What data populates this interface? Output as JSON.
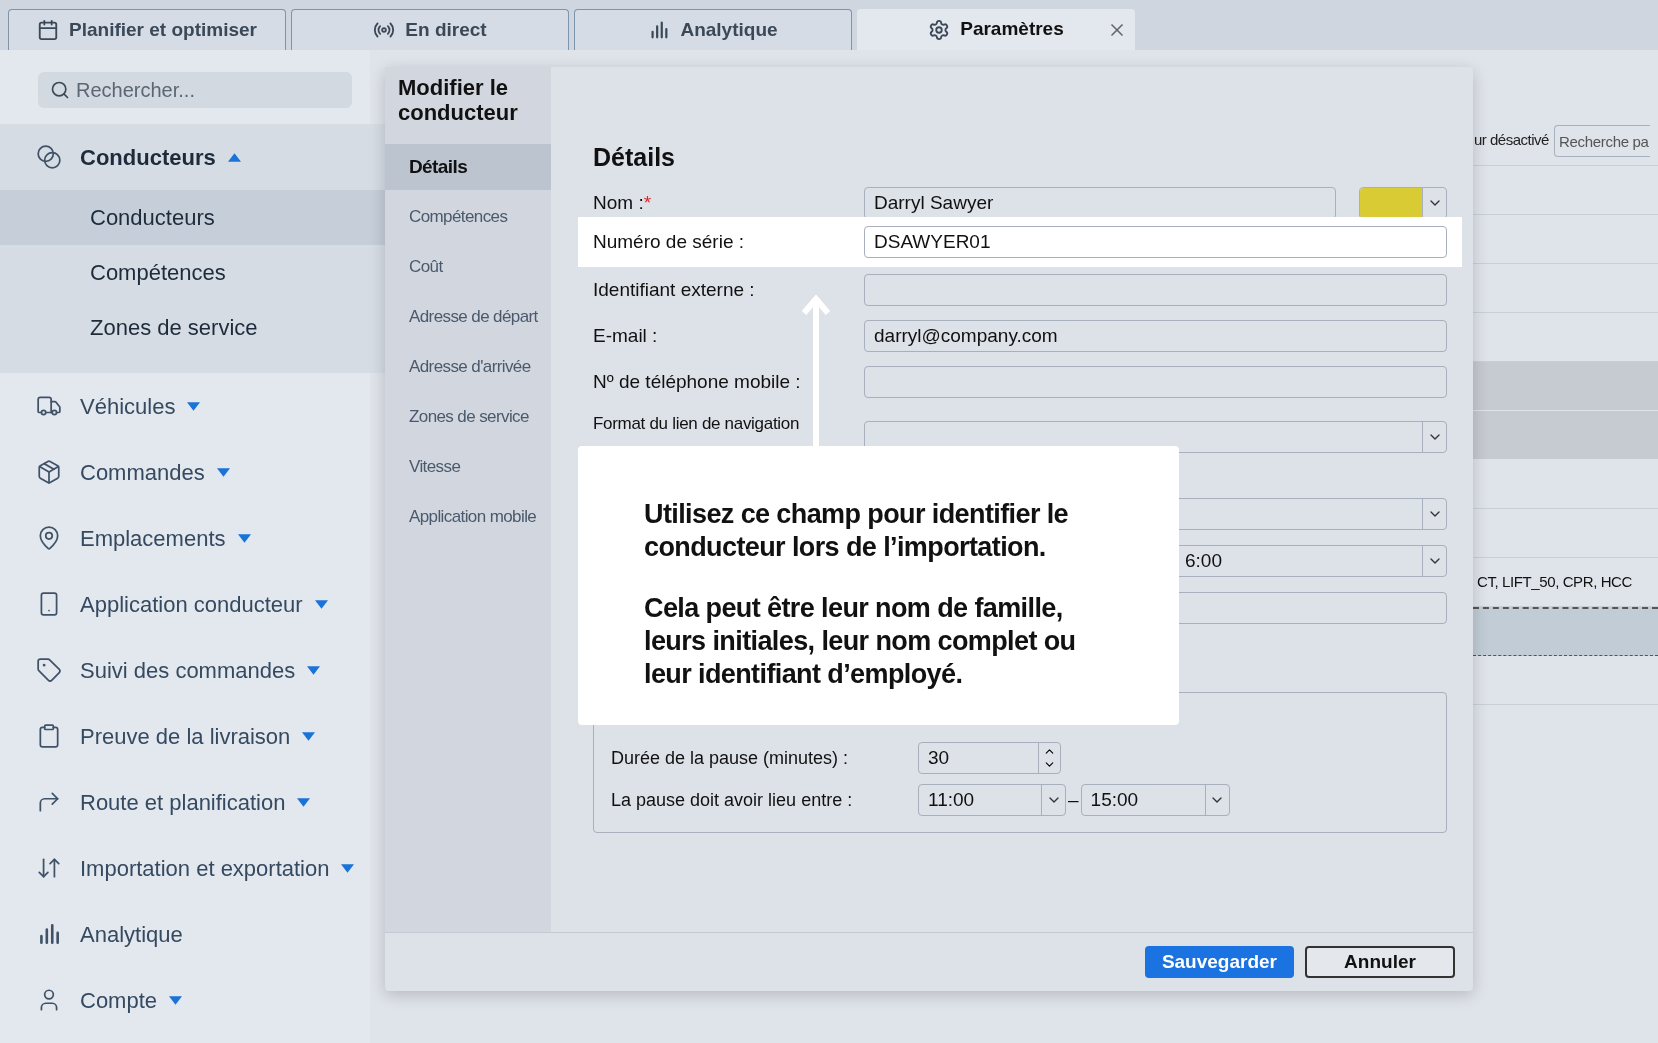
{
  "tabs": [
    {
      "label": "Planifier et optimiser",
      "selected": false
    },
    {
      "label": "En direct",
      "selected": false
    },
    {
      "label": "Analytique",
      "selected": false
    },
    {
      "label": "Paramètres",
      "selected": true
    }
  ],
  "sidebar": {
    "search": {
      "placeholder": "Rechercher..."
    },
    "items": [
      {
        "label": "Conducteurs",
        "kind": "group",
        "expanded": true,
        "children": [
          {
            "label": "Conducteurs",
            "selected": true
          },
          {
            "label": "Compétences",
            "selected": false
          },
          {
            "label": "Zones de service",
            "selected": false
          }
        ]
      },
      {
        "label": "Véhicules",
        "kind": "group",
        "expanded": false
      },
      {
        "label": "Commandes",
        "kind": "group",
        "expanded": false
      },
      {
        "label": "Emplacements",
        "kind": "group",
        "expanded": false
      },
      {
        "label": "Application conducteur",
        "kind": "group",
        "expanded": false
      },
      {
        "label": "Suivi des commandes",
        "kind": "group",
        "expanded": false
      },
      {
        "label": "Preuve de la livraison",
        "kind": "group",
        "expanded": false
      },
      {
        "label": "Route et planification",
        "kind": "group",
        "expanded": false
      },
      {
        "label": "Importation et exportation",
        "kind": "group",
        "expanded": false
      },
      {
        "label": "Analytique",
        "kind": "link"
      },
      {
        "label": "Compte",
        "kind": "group",
        "expanded": false
      }
    ]
  },
  "background": {
    "filter_label": "ur désactivé",
    "search": {
      "placeholder": "Recherche pa"
    },
    "rows": [
      {
        "kind": "plain"
      },
      {
        "kind": "plain"
      },
      {
        "kind": "plain"
      },
      {
        "kind": "plain"
      },
      {
        "kind": "shaded"
      },
      {
        "kind": "shaded"
      },
      {
        "kind": "plain"
      },
      {
        "kind": "plain"
      },
      {
        "kind": "plain",
        "text": "CT, LIFT_50, CPR, HCC"
      },
      {
        "kind": "dashed"
      },
      {
        "kind": "plain"
      }
    ]
  },
  "modal": {
    "title": "Modifier le conducteur",
    "nav": [
      {
        "label": "Détails",
        "selected": true
      },
      {
        "label": "Compétences",
        "selected": false
      },
      {
        "label": "Coût",
        "selected": false
      },
      {
        "label": "Adresse de départ",
        "selected": false
      },
      {
        "label": "Adresse d'arrivée",
        "selected": false
      },
      {
        "label": "Zones de service",
        "selected": false
      },
      {
        "label": "Vitesse",
        "selected": false
      },
      {
        "label": "Application mobile",
        "selected": false
      }
    ],
    "section_title": "Détails",
    "fields": [
      {
        "label": "Nom :",
        "required_mark": "*",
        "kind": "name",
        "value": "Darryl Sawyer",
        "color": "#d8cb33",
        "highlighted": false
      },
      {
        "label": "Numéro de série :",
        "kind": "input",
        "value": "DSAWYER01",
        "highlighted": true
      },
      {
        "label": "Identifiant externe :",
        "kind": "input",
        "highlighted": false
      },
      {
        "label": "E-mail :",
        "kind": "input",
        "value": "darryl@company.com",
        "highlighted": false
      },
      {
        "label": "Nº de téléphone mobile :",
        "kind": "input",
        "highlighted": false
      },
      {
        "label": "Format du lien de navigation",
        "kind": "select",
        "highlighted": false
      }
    ],
    "hidden_fields": [
      {
        "kind": "select"
      },
      {
        "kind": "select",
        "value": "6:00"
      },
      {
        "kind": "input"
      }
    ],
    "break": {
      "duration_label": "Durée de la pause (minutes) :",
      "duration": "30",
      "window_label": "La pause doit avoir lieu entre :",
      "start": "11:00",
      "separator": "–",
      "end": "15:00"
    },
    "buttons": [
      {
        "label": "Sauvegarder",
        "kind": "primary"
      },
      {
        "label": "Annuler",
        "kind": "secondary"
      }
    ]
  },
  "callout": {
    "paragraphs": [
      "Utilisez ce champ pour identifier le conducteur lors de l’importation.",
      "Cela peut être leur nom de famille, leurs initiales, leur nom complet ou leur identifiant d’employé."
    ]
  }
}
